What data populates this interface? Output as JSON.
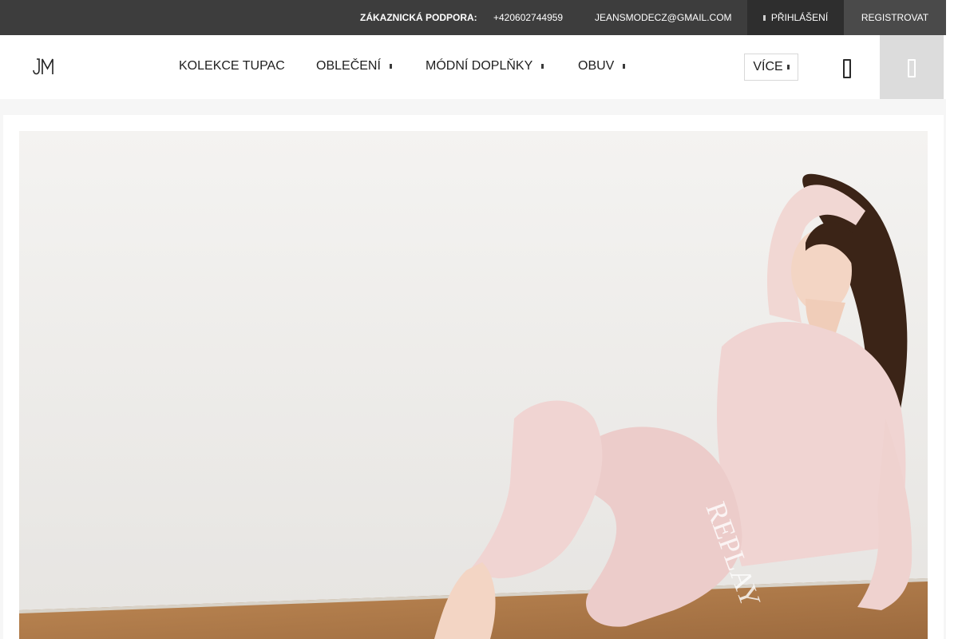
{
  "topbar": {
    "support_label": "ZÁKAZNICKÁ PODPORA:",
    "phone": "+420602744959",
    "email": "JEANSMODECZ@GMAIL.COM",
    "login_label": "PŘIHLÁŠENÍ",
    "register_label": "REGISTROVAT"
  },
  "header": {
    "logo_text": "JM",
    "menu": [
      {
        "label": "KOLEKCE TUPAC",
        "has_dropdown": false
      },
      {
        "label": "OBLEČENÍ",
        "has_dropdown": true
      },
      {
        "label": "MÓDNÍ DOPLŇKY",
        "has_dropdown": true
      },
      {
        "label": "OBUV",
        "has_dropdown": true
      }
    ],
    "more_label": "VÍCE",
    "icons": {
      "user": "user-icon",
      "cart": "cart-icon",
      "dropdown": "chevron-down-icon"
    }
  },
  "hero": {
    "alt": "",
    "garment_text": "REPLAY",
    "colors": {
      "wall": "#f2f1ef",
      "floor": "#b4804f",
      "outfit": "#f0d4d2",
      "hair": "#3b2417"
    }
  },
  "colors": {
    "topbar_bg": "#3d3d3d",
    "login_bg": "#2e2e2e",
    "register_bg": "#4a4a4a",
    "cart_bg": "#dcdcdc"
  }
}
